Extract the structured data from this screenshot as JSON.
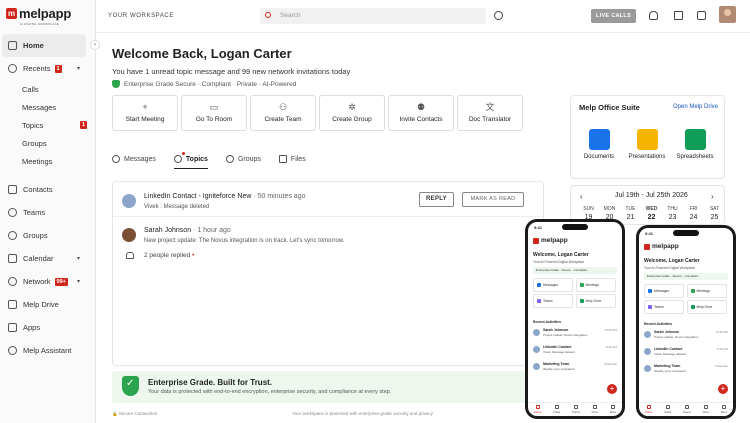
{
  "brand": {
    "logo_letter": "m",
    "name": "melpapp",
    "tagline": "AI DIGITAL WORKPLACE"
  },
  "sidebar": {
    "items": [
      {
        "label": "Home",
        "icon": "home-icon",
        "active": true
      },
      {
        "label": "Recents",
        "icon": "recents-icon",
        "badge": "1"
      },
      {
        "label": "Contacts",
        "icon": "contacts-icon"
      },
      {
        "label": "Teams",
        "icon": "teams-icon"
      },
      {
        "label": "Groups",
        "icon": "groups-icon"
      },
      {
        "label": "Calendar",
        "icon": "calendar-icon"
      },
      {
        "label": "Network",
        "icon": "network-icon",
        "badge": "99+"
      },
      {
        "label": "Melp Drive",
        "icon": "drive-icon"
      },
      {
        "label": "Apps",
        "icon": "apps-icon"
      },
      {
        "label": "Melp Assistant",
        "icon": "assistant-icon"
      }
    ],
    "recents_sub": [
      {
        "label": "Calls"
      },
      {
        "label": "Messages"
      },
      {
        "label": "Topics",
        "badge": "1"
      },
      {
        "label": "Groups"
      },
      {
        "label": "Meetings"
      }
    ]
  },
  "header": {
    "workspace": "YOUR WORKSPACE",
    "search_placeholder": "Search",
    "live_calls": "LIVE CALLS"
  },
  "main": {
    "welcome": "Welcome Back, Logan Carter",
    "unread": "You have 1 unread topic message and 99 new network invitations today",
    "secure": "Enterprise Grade Secure · Compliant · Private · AI-Powered",
    "actions": [
      {
        "label": "Start Meeting",
        "icon": "+"
      },
      {
        "label": "Go To Room",
        "icon": "▭"
      },
      {
        "label": "Create Team",
        "icon": "⚇"
      },
      {
        "label": "Create Group",
        "icon": "✲"
      },
      {
        "label": "Invite Contacts",
        "icon": "⚉"
      },
      {
        "label": "Doc Translator",
        "icon": "文"
      }
    ],
    "tabs": [
      {
        "label": "Messages"
      },
      {
        "label": "Topics",
        "active": true
      },
      {
        "label": "Groups"
      },
      {
        "label": "Files"
      }
    ],
    "feed": {
      "post1": {
        "title": "LinkedIn Contact - Igniteforce New",
        "time": "· 50 minutes ago",
        "sub": "Vivek : Message deleted"
      },
      "post2": {
        "title": "Sarah Johnson",
        "time": "· 1 hour ago",
        "sub": "New project update: The Novus integration is on track. Let's sync tomorrow."
      },
      "reply": "REPLY",
      "mark_read": "MARK AS READ",
      "replied": "2 people replied",
      "replied_dot": "•"
    },
    "banner": {
      "title": "Enterprise Grade. Built for Trust.",
      "sub": "Your data is protected with end-to-end encryption, enterprise security, and compliance at every step."
    },
    "footer_left": "Secure Connection",
    "footer_mid": "Your workspace is protected with enterprise-grade security and privacy"
  },
  "suite": {
    "title": "Melp Office Suite",
    "link": "Open Melp Drive",
    "apps": [
      {
        "label": "Documents",
        "color": "#1a73e8"
      },
      {
        "label": "Presentations",
        "color": "#f4b400"
      },
      {
        "label": "Spreadsheets",
        "color": "#0f9d58"
      }
    ]
  },
  "calendar": {
    "prev": "‹",
    "next": "›",
    "range": "Jul 19th - Jul 25th 2026",
    "days": [
      {
        "d": "SUN",
        "n": "19"
      },
      {
        "d": "MON",
        "n": "20"
      },
      {
        "d": "TUE",
        "n": "21"
      },
      {
        "d": "WED",
        "n": "22",
        "today": true
      },
      {
        "d": "THU",
        "n": "23"
      },
      {
        "d": "FRI",
        "n": "24"
      },
      {
        "d": "SAT",
        "n": "25"
      }
    ]
  },
  "phone": {
    "time": "9:41",
    "name": "melpapp",
    "welcome": "Welcome, Logan Carter",
    "sub": "Your AI-Powered Digital Workplace",
    "grade": "Enterprise Grade · Secure · Compliant",
    "buttons": [
      "Messages",
      "Meetings",
      "Teams",
      "Melp Drive"
    ],
    "recent_title": "Recent Activities",
    "recent": [
      {
        "name": "Sarah Johnson",
        "text": "Project update: Novus integration",
        "time": "10:25 AM"
      },
      {
        "name": "LinkedIn Contact",
        "text": "Vivek: Message deleted",
        "time": "9:40 AM"
      },
      {
        "name": "Marketing Team",
        "text": "Weekly sync completed",
        "time": "Yesterday"
      }
    ],
    "tabs": [
      "Home",
      "Chats",
      "Teams",
      "Drive",
      "More"
    ],
    "fab": "+"
  },
  "colors": {
    "brand": "#d0271d",
    "success": "#2da44e",
    "link": "#1a56c4"
  }
}
